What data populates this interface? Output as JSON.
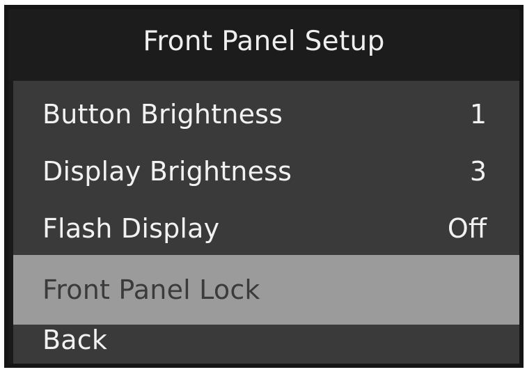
{
  "header": {
    "title": "Front Panel Setup"
  },
  "menu": {
    "items": [
      {
        "label": "Button Brightness",
        "value": "1"
      },
      {
        "label": "Display Brightness",
        "value": "3"
      },
      {
        "label": "Flash Display",
        "value": "Off"
      },
      {
        "label": "Front Panel Lock",
        "value": ""
      },
      {
        "label": "Back",
        "value": ""
      }
    ],
    "selected_index": 3
  },
  "colors": {
    "background": "#1a1a1a",
    "menu_background": "#3a3a3a",
    "selected_highlight": "#9b9b9b",
    "text": "#f2f2f2",
    "selected_text": "#3b3b3b"
  }
}
